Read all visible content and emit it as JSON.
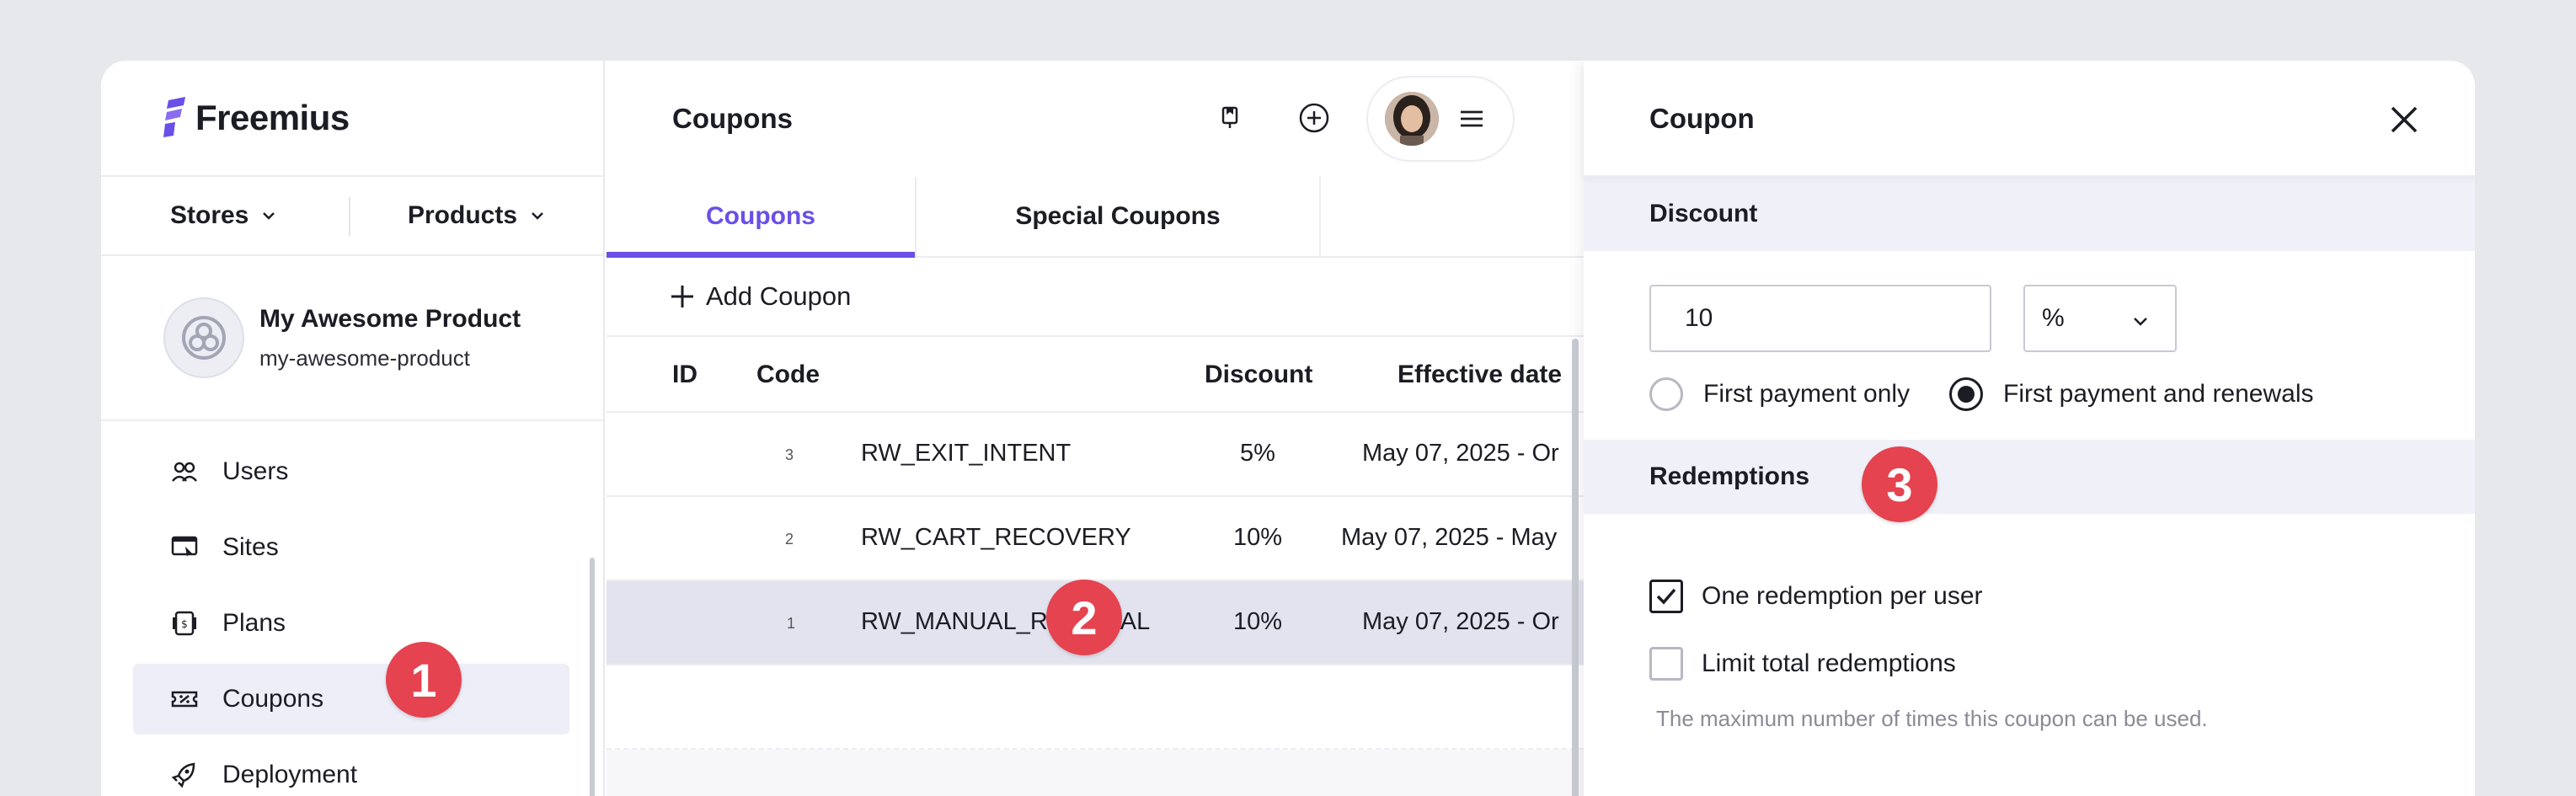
{
  "brand": {
    "name": "Freemius",
    "accent": "#6b4fe6"
  },
  "sidebar": {
    "stores_label": "Stores",
    "products_label": "Products",
    "product": {
      "name": "My Awesome Product",
      "slug": "my-awesome-product"
    },
    "items": [
      {
        "label": "Users",
        "icon": "users-icon"
      },
      {
        "label": "Sites",
        "icon": "sites-icon"
      },
      {
        "label": "Plans",
        "icon": "plans-icon"
      },
      {
        "label": "Coupons",
        "icon": "coupon-icon",
        "active": true
      },
      {
        "label": "Deployment",
        "icon": "deployment-icon"
      }
    ]
  },
  "main": {
    "title": "Coupons",
    "tabs": [
      {
        "label": "Coupons",
        "active": true
      },
      {
        "label": "Special Coupons"
      }
    ],
    "add_label": "Add Coupon",
    "columns": {
      "id": "ID",
      "code": "Code",
      "discount": "Discount",
      "effective": "Effective date"
    },
    "rows": [
      {
        "id": "3",
        "code": "RW_EXIT_INTENT",
        "discount": "5%",
        "effective": "May 07, 2025 - Or"
      },
      {
        "id": "2",
        "code": "RW_CART_RECOVERY",
        "discount": "10%",
        "effective": "May 07, 2025 - May"
      },
      {
        "id": "1",
        "code": "RW_MANUAL_RENEWAL",
        "discount": "10%",
        "effective": "May 07, 2025 - Or",
        "selected": true
      }
    ]
  },
  "panel": {
    "title": "Coupon",
    "discount_section": "Discount",
    "discount_value": "10",
    "discount_type": "%",
    "radio_first_only": "First payment only",
    "radio_renewals": "First payment and renewals",
    "redemptions_section": "Redemptions",
    "check_one_per_user": "One redemption per user",
    "check_limit_total": "Limit total redemptions",
    "hint": "The maximum number of times this coupon can be used."
  },
  "badges": {
    "one": "1",
    "two": "2",
    "three": "3",
    "color": "#e5434f"
  }
}
